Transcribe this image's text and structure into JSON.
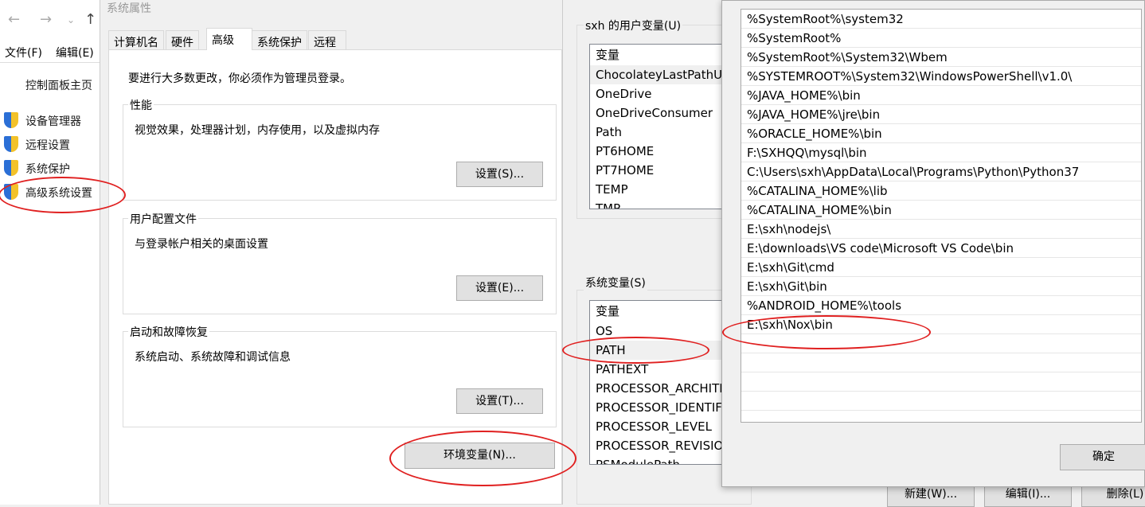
{
  "explorer": {
    "nav": {
      "back": "←",
      "forward": "→",
      "dropdown": "⌄",
      "up": "↑"
    },
    "menu": [
      "文件(F)",
      "编辑(E)"
    ],
    "home": "控制面板主页",
    "items": [
      "设备管理器",
      "远程设置",
      "系统保护",
      "高级系统设置"
    ]
  },
  "sysprop": {
    "title": "系统属性",
    "tabs": [
      "计算机名",
      "硬件",
      "高级",
      "系统保护",
      "远程"
    ],
    "active_tab": "高级",
    "admin_note": "要进行大多数更改，你必须作为管理员登录。",
    "groups": [
      {
        "label": "性能",
        "desc": "视觉效果，处理器计划，内存使用，以及虚拟内存",
        "button": "设置(S)..."
      },
      {
        "label": "用户配置文件",
        "desc": "与登录帐户相关的桌面设置",
        "button": "设置(E)..."
      },
      {
        "label": "启动和故障恢复",
        "desc": "系统启动、系统故障和调试信息",
        "button": "设置(T)..."
      }
    ],
    "env_button": "环境变量(N)..."
  },
  "envvars": {
    "user_label": "sxh 的用户变量(U)",
    "user_header": "变量",
    "user_vars": [
      "ChocolateyLastPathUp",
      "OneDrive",
      "OneDriveConsumer",
      "Path",
      "PT6HOME",
      "PT7HOME",
      "TEMP",
      "TMP"
    ],
    "sys_label": "系统变量(S)",
    "sys_header": "变量",
    "sys_vars": [
      "OS",
      "PATH",
      "PATHEXT",
      "PROCESSOR_ARCHITE",
      "PROCESSOR_IDENTIFIE",
      "PROCESSOR_LEVEL",
      "PROCESSOR_REVISION",
      "PSModulePath"
    ],
    "selected_sys": "PATH",
    "buttons": {
      "new": "新建(W)...",
      "edit": "编辑(I)...",
      "delete": "删除(L)"
    }
  },
  "editdlg": {
    "entries": [
      "%SystemRoot%\\system32",
      "%SystemRoot%",
      "%SystemRoot%\\System32\\Wbem",
      "%SYSTEMROOT%\\System32\\WindowsPowerShell\\v1.0\\",
      "%JAVA_HOME%\\bin",
      "%JAVA_HOME%\\jre\\bin",
      "%ORACLE_HOME%\\bin",
      "F:\\SXHQQ\\mysql\\bin",
      "C:\\Users\\sxh\\AppData\\Local\\Programs\\Python\\Python37",
      "%CATALINA_HOME%\\lib",
      "%CATALINA_HOME%\\bin",
      "E:\\sxh\\nodejs\\",
      "E:\\downloads\\VS code\\Microsoft VS Code\\bin",
      "E:\\sxh\\Git\\cmd",
      "E:\\sxh\\Git\\bin",
      "%ANDROID_HOME%\\tools",
      "E:\\sxh\\Nox\\bin"
    ],
    "ok": "确定"
  },
  "annotation_color": "#e02020"
}
